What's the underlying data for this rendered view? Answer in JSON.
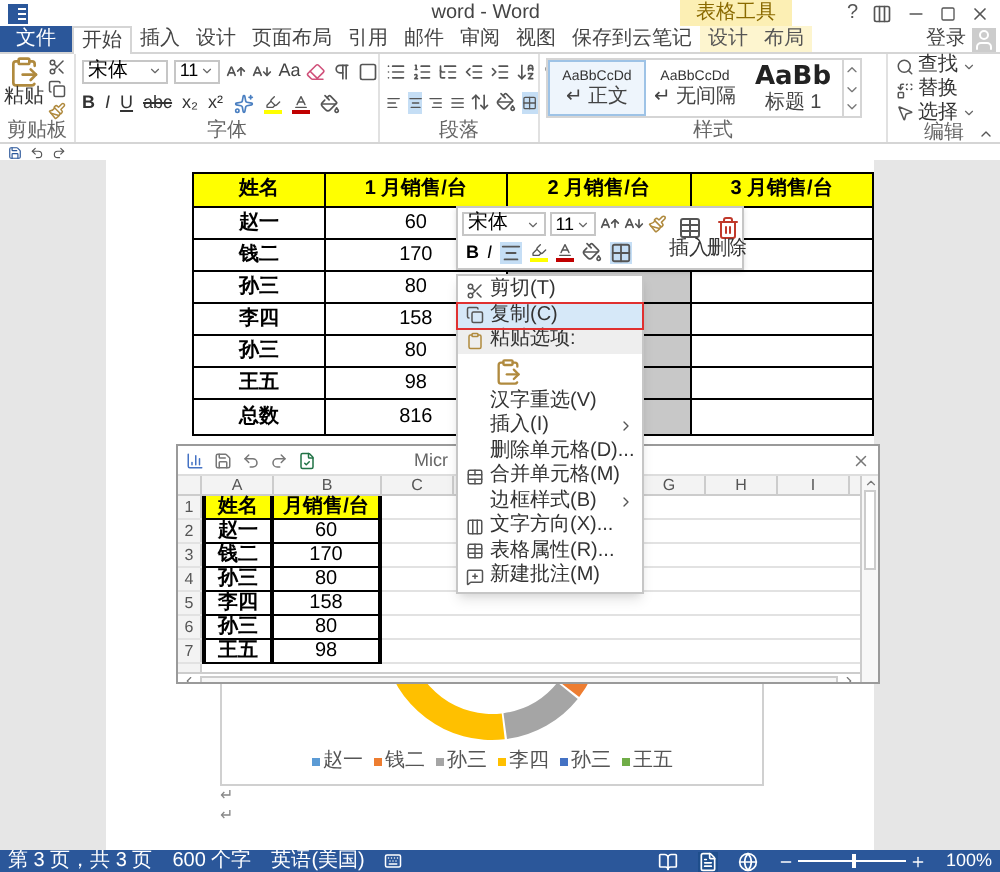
{
  "window": {
    "title": "word - Word",
    "context_group": "表格工具",
    "help": "?",
    "sign_in": "登录"
  },
  "tabs": [
    {
      "label": "文件",
      "kind": "file",
      "selected": false
    },
    {
      "label": "开始",
      "kind": "normal",
      "selected": true
    },
    {
      "label": "插入",
      "kind": "normal",
      "selected": false
    },
    {
      "label": "设计",
      "kind": "normal",
      "selected": false
    },
    {
      "label": "页面布局",
      "kind": "normal",
      "selected": false
    },
    {
      "label": "引用",
      "kind": "normal",
      "selected": false
    },
    {
      "label": "邮件",
      "kind": "normal",
      "selected": false
    },
    {
      "label": "审阅",
      "kind": "normal",
      "selected": false
    },
    {
      "label": "视图",
      "kind": "normal",
      "selected": false
    },
    {
      "label": "保存到云笔记",
      "kind": "normal",
      "selected": false
    },
    {
      "label": "设计",
      "kind": "context",
      "selected": false
    },
    {
      "label": "布局",
      "kind": "context",
      "selected": false
    }
  ],
  "ribbon": {
    "clipboard": {
      "paste": "粘贴",
      "label": "剪贴板"
    },
    "font": {
      "name": "宋体",
      "size": "11",
      "case": "Aa",
      "format_buttons": [
        "B",
        "I",
        "U",
        "abc",
        "x₂",
        "x²"
      ],
      "label": "字体"
    },
    "paragraph": {
      "align": [
        {
          "kind": "left",
          "selected": false
        },
        {
          "kind": "center",
          "selected": true
        },
        {
          "kind": "right",
          "selected": false
        },
        {
          "kind": "justify",
          "selected": false
        }
      ],
      "label": "段落"
    },
    "styles": {
      "items": [
        {
          "preview": "AaBbCcDd",
          "name": "↵ 正文",
          "kind": "normal",
          "selected": true
        },
        {
          "preview": "AaBbCcDd",
          "name": "↵ 无间隔",
          "kind": "normal",
          "selected": false
        },
        {
          "preview": "AaBb",
          "name": "标题 1",
          "kind": "heading",
          "selected": false
        }
      ],
      "label": "样式"
    },
    "editing": {
      "items": [
        {
          "label": "查找",
          "kind": "find",
          "dropdown": true
        },
        {
          "label": "替换",
          "kind": "replace",
          "dropdown": false
        },
        {
          "label": "选择",
          "kind": "select",
          "dropdown": true
        }
      ],
      "label": "编辑"
    }
  },
  "table": {
    "columns": [
      {
        "label": "姓名",
        "selected": false
      },
      {
        "label": "1 月销售/台",
        "selected": false
      },
      {
        "label": "2 月销售/台",
        "selected": true
      },
      {
        "label": "3 月销售/台",
        "selected": false
      }
    ],
    "rows": [
      [
        "赵一",
        "60"
      ],
      [
        "钱二",
        "170"
      ],
      [
        "孙三",
        "80"
      ],
      [
        "李四",
        "158"
      ],
      [
        "孙三",
        "80"
      ],
      [
        "王五",
        "98"
      ],
      [
        "总数",
        "816"
      ]
    ]
  },
  "mini_toolbar": {
    "font": "宋体",
    "size": "11",
    "bold": "B",
    "italic": "I",
    "insert": "插入",
    "delete": "删除"
  },
  "context_menu": [
    {
      "label": "剪切(T)",
      "kind": "cut",
      "submenu": false,
      "selected": false
    },
    {
      "label": "复制(C)",
      "kind": "copy",
      "submenu": false,
      "selected": true
    },
    {
      "label": "粘贴选项:",
      "kind": "paste-header",
      "submenu": false,
      "selected": false
    },
    {
      "kind": "paste-button",
      "submenu": false,
      "selected": false
    },
    {
      "label": "汉字重选(V)",
      "kind": "plain",
      "submenu": false,
      "selected": false
    },
    {
      "label": "插入(I)",
      "kind": "plain",
      "submenu": true,
      "selected": false
    },
    {
      "label": "删除单元格(D)...",
      "kind": "plain",
      "submenu": false,
      "selected": false
    },
    {
      "label": "合并单元格(M)",
      "kind": "merge",
      "submenu": false,
      "selected": false
    },
    {
      "label": "边框样式(B)",
      "kind": "plain",
      "submenu": true,
      "selected": false
    },
    {
      "label": "文字方向(X)...",
      "kind": "text-direction",
      "submenu": false,
      "selected": false
    },
    {
      "label": "表格属性(R)...",
      "kind": "table-properties",
      "submenu": false,
      "selected": false
    },
    {
      "label": "新建批注(M)",
      "kind": "comment",
      "submenu": false,
      "selected": false
    }
  ],
  "excel": {
    "title": "Micr",
    "columns_left": [
      "A",
      "B",
      "C"
    ],
    "columns_right": [
      "G",
      "H",
      "I"
    ],
    "rows": [
      {
        "number": "1",
        "kind": "header",
        "cells": [
          "姓名",
          "月销售/台"
        ]
      },
      {
        "number": "2",
        "kind": "data",
        "cells": [
          "赵一",
          "60"
        ]
      },
      {
        "number": "3",
        "kind": "data",
        "cells": [
          "钱二",
          "170"
        ]
      },
      {
        "number": "4",
        "kind": "data",
        "cells": [
          "孙三",
          "80"
        ]
      },
      {
        "number": "5",
        "kind": "data",
        "cells": [
          "李四",
          "158"
        ]
      },
      {
        "number": "6",
        "kind": "data",
        "cells": [
          "孙三",
          "80"
        ]
      },
      {
        "number": "7",
        "kind": "data",
        "cells": [
          "王五",
          "98"
        ]
      }
    ]
  },
  "chart": {
    "legend": [
      {
        "label": "赵一",
        "color": "#5b9bd5"
      },
      {
        "label": "钱二",
        "color": "#ed7d31"
      },
      {
        "label": "孙三",
        "color": "#a5a5a5"
      },
      {
        "label": "李四",
        "color": "#ffc000"
      },
      {
        "label": "孙三",
        "color": "#4472c4"
      },
      {
        "label": "王五",
        "color": "#70ad47"
      }
    ]
  },
  "paragraph_marks": [
    "↵",
    "↵"
  ],
  "status_bar": {
    "items": [
      "第 3 页，共 3 页",
      "600 个字",
      "英语(美国)"
    ],
    "views": [
      {
        "kind": "read",
        "selected": false
      },
      {
        "kind": "print",
        "selected": true
      },
      {
        "kind": "web",
        "selected": false
      }
    ],
    "zoom": {
      "level": 0.5,
      "reading": "100%"
    }
  }
}
